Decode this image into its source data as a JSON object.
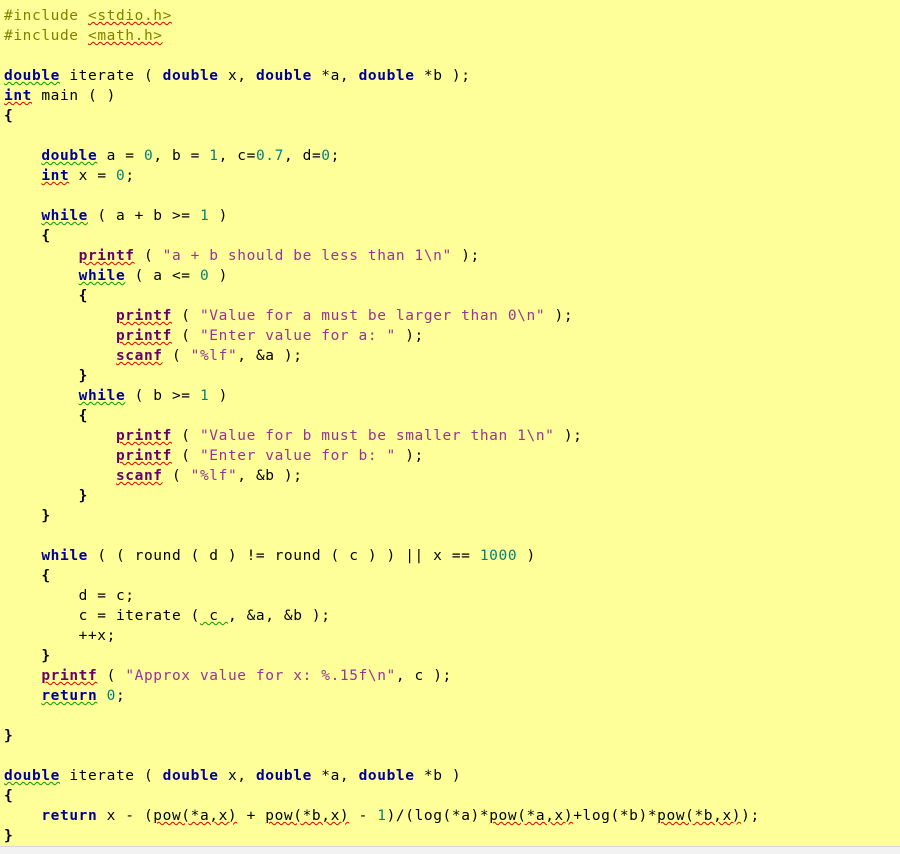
{
  "editor": {
    "background_color": "#ffff99",
    "language": "C",
    "colors": {
      "preprocessor": "#808000",
      "keyword": "#000099",
      "number": "#008080",
      "string": "#993399",
      "library_function": "#660066",
      "plain_text": "#000000",
      "spellcheck_red": "#dd0000",
      "spellcheck_green": "#009900",
      "bottom_strip": "#f2f2f2"
    }
  },
  "code": {
    "lines": [
      {
        "id": "l01",
        "text": "#include <stdio.h>"
      },
      {
        "id": "l02",
        "text": "#include <math.h>"
      },
      {
        "id": "l03",
        "text": ""
      },
      {
        "id": "l04",
        "text": "double iterate ( double x, double *a, double *b );"
      },
      {
        "id": "l05",
        "text": "int main ( )"
      },
      {
        "id": "l06",
        "text": "{"
      },
      {
        "id": "l07",
        "text": ""
      },
      {
        "id": "l08",
        "text": "    double a = 0, b = 1, c=0.7, d=0;"
      },
      {
        "id": "l09",
        "text": "    int x = 0;"
      },
      {
        "id": "l10",
        "text": ""
      },
      {
        "id": "l11",
        "text": "    while ( a + b >= 1 )"
      },
      {
        "id": "l12",
        "text": "    {"
      },
      {
        "id": "l13",
        "text": "        printf ( \"a + b should be less than 1\\n\" );"
      },
      {
        "id": "l14",
        "text": "        while ( a <= 0 )"
      },
      {
        "id": "l15",
        "text": "        {"
      },
      {
        "id": "l16",
        "text": "            printf ( \"Value for a must be larger than 0\\n\" );"
      },
      {
        "id": "l17",
        "text": "            printf ( \"Enter value for a: \" );"
      },
      {
        "id": "l18",
        "text": "            scanf ( \"%lf\", &a );"
      },
      {
        "id": "l19",
        "text": "        }"
      },
      {
        "id": "l20",
        "text": "        while ( b >= 1 )"
      },
      {
        "id": "l21",
        "text": "        {"
      },
      {
        "id": "l22",
        "text": "            printf ( \"Value for b must be smaller than 1\\n\" );"
      },
      {
        "id": "l23",
        "text": "            printf ( \"Enter value for b: \" );"
      },
      {
        "id": "l24",
        "text": "            scanf ( \"%lf\", &b );"
      },
      {
        "id": "l25",
        "text": "        }"
      },
      {
        "id": "l26",
        "text": "    }"
      },
      {
        "id": "l27",
        "text": ""
      },
      {
        "id": "l28",
        "text": "    while ( ( round ( d ) != round ( c ) ) || x == 1000 )"
      },
      {
        "id": "l29",
        "text": "    {"
      },
      {
        "id": "l30",
        "text": "        d = c;"
      },
      {
        "id": "l31",
        "text": "        c = iterate ( c , &a, &b );"
      },
      {
        "id": "l32",
        "text": "        ++x;"
      },
      {
        "id": "l33",
        "text": "    }"
      },
      {
        "id": "l34",
        "text": "    printf ( \"Approx value for x: %.15f\\n\", c );"
      },
      {
        "id": "l35",
        "text": "    return 0;"
      },
      {
        "id": "l36",
        "text": ""
      },
      {
        "id": "l37",
        "text": "}"
      },
      {
        "id": "l38",
        "text": ""
      },
      {
        "id": "l39",
        "text": "double iterate ( double x, double *a, double *b )"
      },
      {
        "id": "l40",
        "text": "{"
      },
      {
        "id": "l41",
        "text": "    return x - (pow(*a,x) + pow(*b,x) - 1)/(log(*a)*pow(*a,x)+log(*b)*pow(*b,x));"
      },
      {
        "id": "l42",
        "text": "}"
      }
    ],
    "tokens": {
      "include_1_directive": "#include",
      "include_1_header": "<stdio.h>",
      "include_2_directive": "#include",
      "include_2_header": "<math.h>",
      "kw_double": "double",
      "kw_int": "int",
      "kw_while": "while",
      "kw_return": "return",
      "fn_iterate": "iterate",
      "fn_main": "main",
      "fn_printf": "printf",
      "fn_scanf": "scanf",
      "fn_round": "round",
      "fn_pow": "pow",
      "fn_log": "log",
      "str_a_plus_b": "\"a + b should be less than 1\\n\"",
      "str_value_a": "\"Value for a must be larger than 0\\n\"",
      "str_enter_a": "\"Enter value for a: \"",
      "str_fmt_lf": "\"%lf\"",
      "str_value_b": "\"Value for b must be smaller than 1\\n\"",
      "str_enter_b": "\"Enter value for b: \"",
      "str_approx": "\"Approx value for x: %.15f\\n\"",
      "num_0": "0",
      "num_1": "1",
      "num_07": "0.7",
      "num_1000": "1000"
    }
  }
}
